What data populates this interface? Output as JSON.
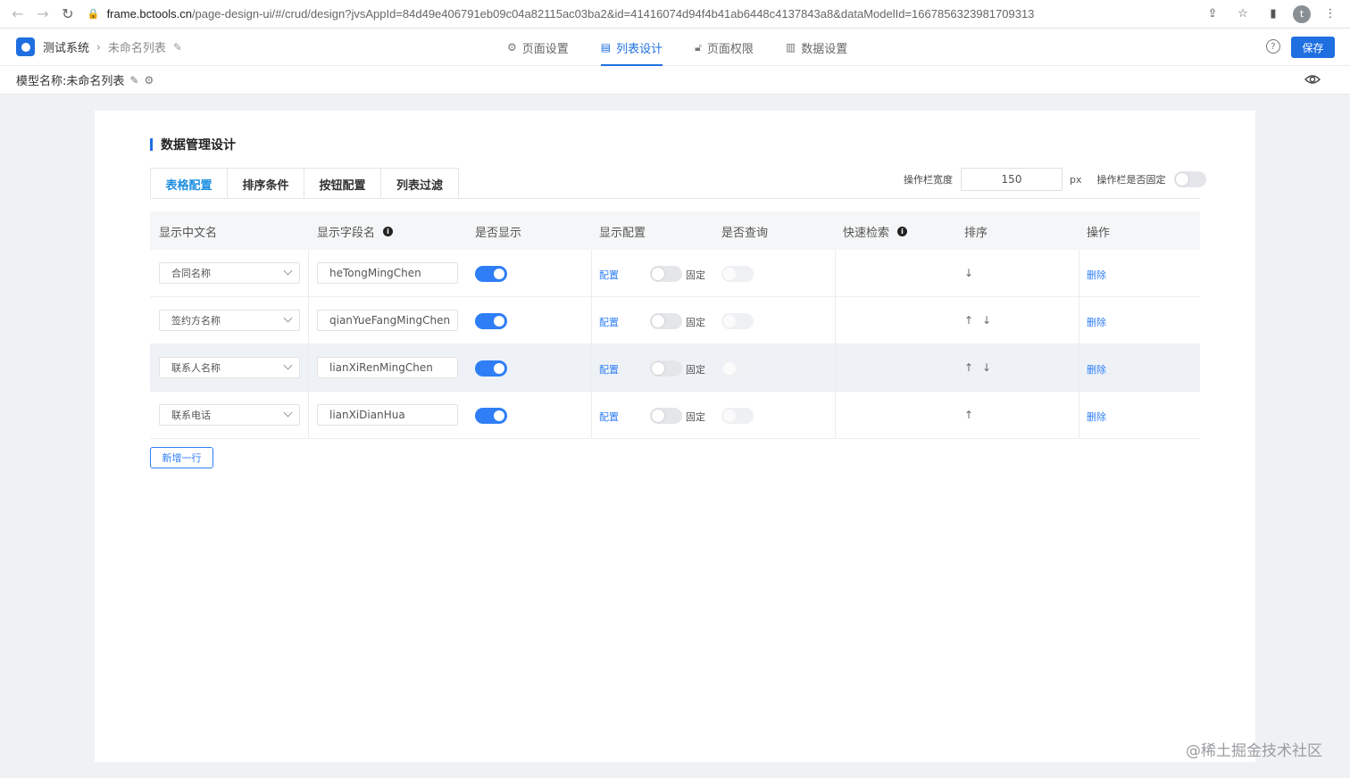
{
  "browser": {
    "url_host": "frame.bctools.cn",
    "url_path": "/page-design-ui/#/crud/design?jvsAppId=84d49e406791eb09c04a82115ac03ba2&id=41416074d94f4b41ab6448c4137843a8&dataModelId=1667856323981709313",
    "profile_initial": "t"
  },
  "header": {
    "brand": "测试系统",
    "page_name": "未命名列表",
    "tabs": [
      {
        "label": "页面设置"
      },
      {
        "label": "列表设计"
      },
      {
        "label": "页面权限"
      },
      {
        "label": "数据设置"
      }
    ],
    "save_label": "保存"
  },
  "model_bar": {
    "label": "模型名称:",
    "value": "未命名列表"
  },
  "main": {
    "title": "数据管理设计",
    "sub_tabs": [
      {
        "label": "表格配置"
      },
      {
        "label": "排序条件"
      },
      {
        "label": "按钮配置"
      },
      {
        "label": "列表过滤"
      }
    ],
    "op_width_label": "操作栏宽度",
    "op_width_value": "150",
    "op_width_unit": "px",
    "op_fixed_label": "操作栏是否固定",
    "columns": {
      "display_name": "显示中文名",
      "field_name": "显示字段名",
      "show": "是否显示",
      "display_config": "显示配置",
      "query": "是否查询",
      "quick_search": "快速检索",
      "sort": "排序",
      "actions": "操作"
    },
    "rows": [
      {
        "display_name": "合同名称",
        "field_name": "heTongMingChen",
        "config": "配置",
        "fixed": "固定",
        "up": "",
        "down": "↓",
        "delete": "删除"
      },
      {
        "display_name": "签约方名称",
        "field_name": "qianYueFangMingChen",
        "config": "配置",
        "fixed": "固定",
        "up": "↑",
        "down": "↓",
        "delete": "删除"
      },
      {
        "display_name": "联系人名称",
        "field_name": "lianXiRenMingChen",
        "config": "配置",
        "fixed": "固定",
        "up": "↑",
        "down": "↓",
        "delete": "删除"
      },
      {
        "display_name": "联系电话",
        "field_name": "lianXiDianHua",
        "config": "配置",
        "fixed": "固定",
        "up": "↑",
        "down": "",
        "delete": "删除"
      }
    ],
    "add_row_label": "新增一行"
  },
  "footer_mark": "@稀土掘金技术社区",
  "colors": {
    "primary": "#1f6fe0",
    "switch_on": "#2f7ef5",
    "highlight_row": "#eef2f7"
  }
}
